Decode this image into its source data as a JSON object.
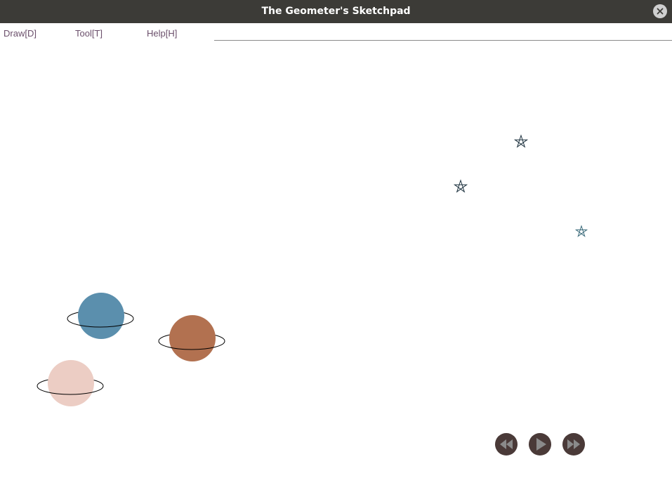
{
  "window": {
    "title": "The Geometer's Sketchpad",
    "close_icon": "close-icon"
  },
  "menu": {
    "items": [
      {
        "label": "Draw[D]"
      },
      {
        "label": "Tool[T]"
      },
      {
        "label": "Help[H]"
      }
    ],
    "text_color": "#6b4f6b"
  },
  "canvas": {
    "planets": [
      {
        "name": "blue-planet",
        "color": "#5b8fad"
      },
      {
        "name": "brown-planet",
        "color": "#b27150"
      },
      {
        "name": "pink-planet",
        "color": "#eccdc4"
      }
    ],
    "stars": [
      {
        "name": "star-1",
        "color": "#1f3340"
      },
      {
        "name": "star-2",
        "color": "#1f3340"
      },
      {
        "name": "star-3",
        "color": "#3a6a7a"
      }
    ]
  },
  "controls": {
    "button_color": "#4a3a38",
    "icon_color": "#8a8a8a",
    "buttons": [
      {
        "icon": "rewind-icon"
      },
      {
        "icon": "play-icon"
      },
      {
        "icon": "fast-forward-icon"
      }
    ]
  }
}
